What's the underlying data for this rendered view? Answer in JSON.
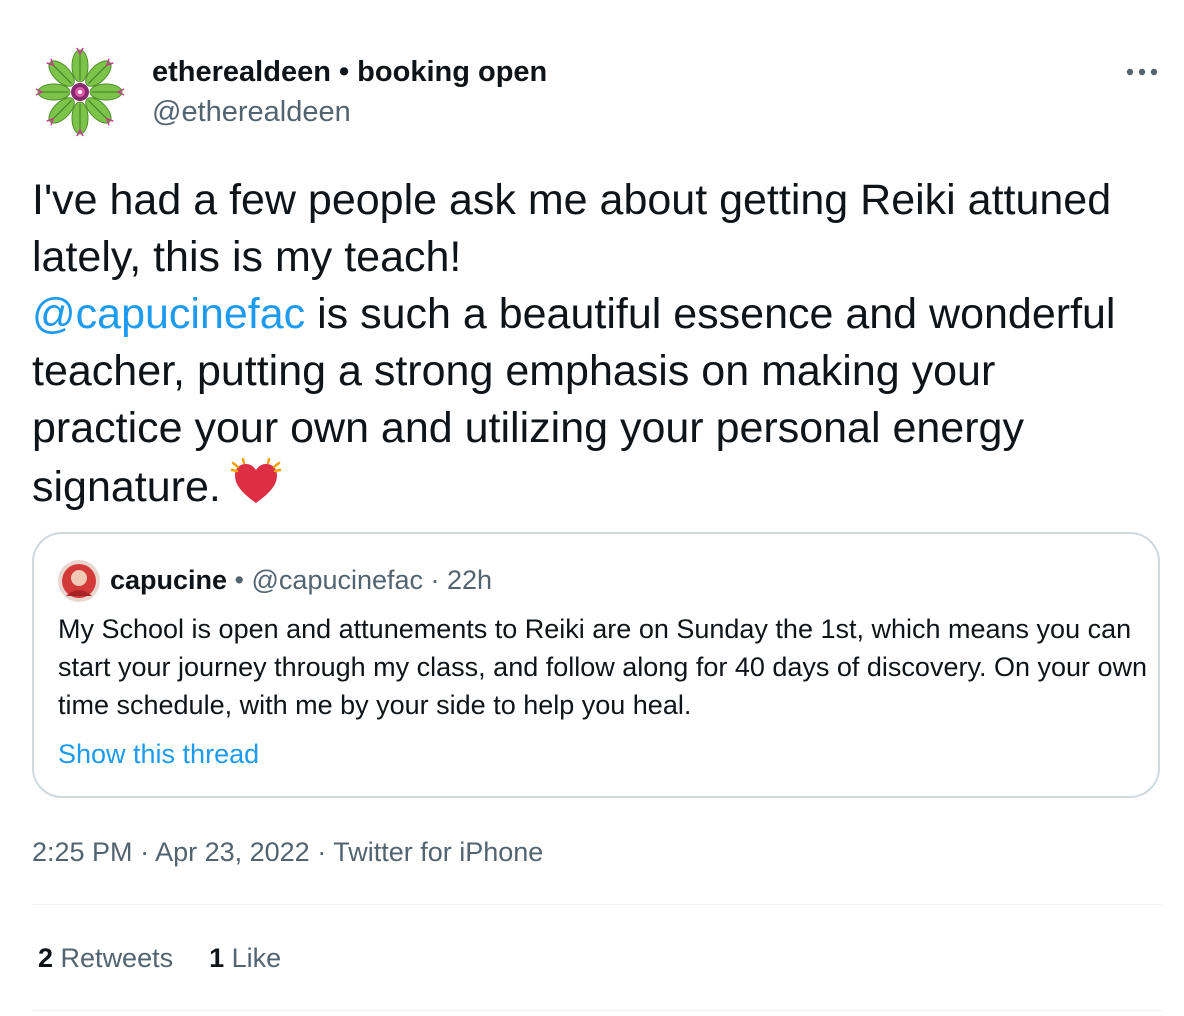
{
  "author": {
    "name": "etherealdeen • booking open",
    "handle": "@etherealdeen"
  },
  "tweet": {
    "line1": "I've had a few people ask me about getting Reiki attuned lately, this is my teach!",
    "mention": "@capucinefac",
    "line2": " is such a beautiful essence and wonderful teacher, putting a strong emphasis on making your practice your own and utilizing your personal energy signature.",
    "emoji": "beating-heart"
  },
  "quote": {
    "name": "capucine",
    "separator": " • ",
    "handle": "@capucinefac",
    "time": " · 22h",
    "text": "My School is open and attunements to Reiki are on Sunday the 1st, which means you can start your journey through my class, and follow along for 40 days of discovery. On your own time schedule, with me by your side to help you heal.",
    "thread_link": "Show this thread"
  },
  "meta": {
    "time": "2:25 PM",
    "date": "Apr 23, 2022",
    "source": "Twitter for iPhone",
    "dot": " · "
  },
  "stats": {
    "retweets_count": "2",
    "retweets_label": "Retweets",
    "likes_count": "1",
    "likes_label": "Like"
  },
  "colors": {
    "link": "#1d9bf0",
    "secondary_text": "#536471",
    "primary_text": "#0f1419",
    "border": "#cfd9de",
    "heart": "#e0245e"
  },
  "icons": {
    "more": "more-horizontal-icon",
    "avatar_logo": "mandala-leaf-logo"
  }
}
